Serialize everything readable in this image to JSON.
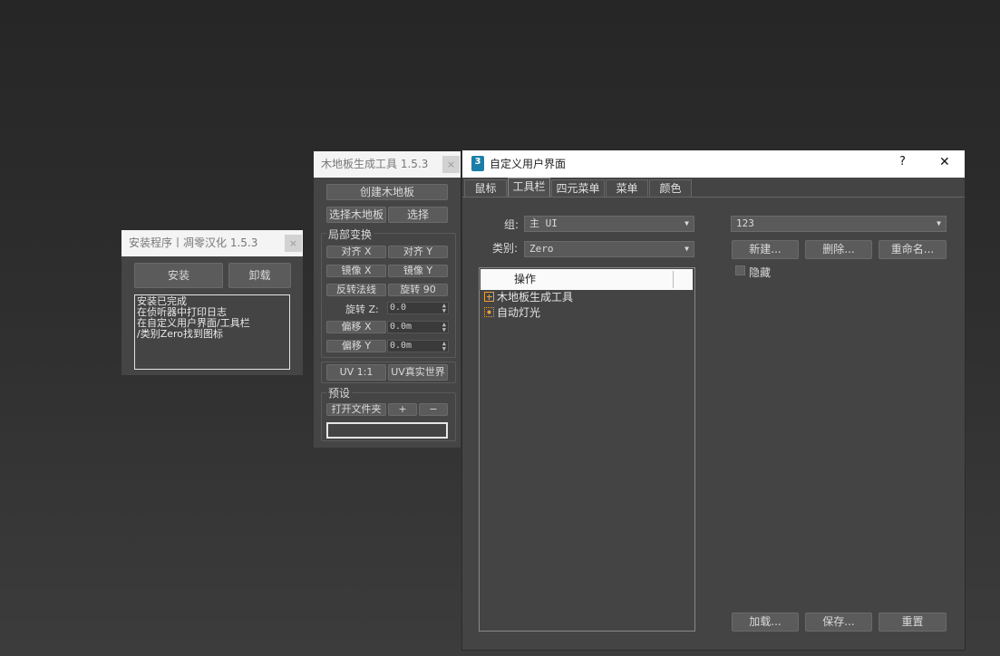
{
  "installer": {
    "title": "安装程序丨凋零汉化 1.5.3",
    "close": "×",
    "install_btn": "安装",
    "uninstall_btn": "卸载",
    "log": [
      "安装已完成",
      "在侦听器中打印日志",
      "在自定义用户界面/工具栏",
      "/类别Zero找到图标"
    ]
  },
  "floor_tool": {
    "title": "木地板生成工具 1.5.3",
    "close": "×",
    "create_btn": "创建木地板",
    "select_floor_btn": "选择木地板",
    "select_btn": "选择",
    "local_transform": "局部变换",
    "align_x": "对齐 X",
    "align_y": "对齐 Y",
    "mirror_x": "镜像 X",
    "mirror_y": "镜像 Y",
    "flip_normal": "反转法线",
    "rotate_90": "旋转 90",
    "rotate_z_label": "旋转 Z:",
    "rotate_z_value": "0.0",
    "offset_x_btn": "偏移 X",
    "offset_x_value": "0.0m",
    "offset_y_btn": "偏移 Y",
    "offset_y_value": "0.0m",
    "uv_11": "UV 1:1",
    "uv_real": "UV真实世界",
    "preset_label": "预设",
    "open_folder": "打开文件夹",
    "plus": "+",
    "minus": "−"
  },
  "cui": {
    "title": "自定义用户界面",
    "help": "?",
    "close": "✕",
    "app_icon": "3",
    "tabs": [
      "鼠标",
      "工具栏",
      "四元菜单",
      "菜单",
      "颜色"
    ],
    "group_label": "组:",
    "group_value": "主 UI",
    "category_label": "类别:",
    "category_value": "Zero",
    "action_header": "操作",
    "actions": [
      "木地板生成工具",
      "自动灯光"
    ],
    "toolbar_value": "123",
    "new_btn": "新建...",
    "delete_btn": "删除...",
    "rename_btn": "重命名...",
    "hide_label": "隐藏",
    "load_btn": "加载...",
    "save_btn": "保存...",
    "reset_btn": "重置"
  }
}
